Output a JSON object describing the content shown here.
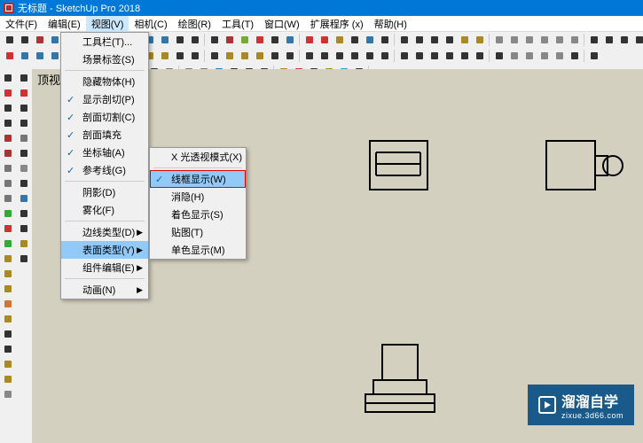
{
  "titlebar": {
    "appicon": "SU",
    "title": "无标题 - SketchUp Pro 2018"
  },
  "menubar": [
    {
      "label": "文件(F)"
    },
    {
      "label": "编辑(E)"
    },
    {
      "label": "视图(V)",
      "active": true
    },
    {
      "label": "相机(C)"
    },
    {
      "label": "绘图(R)"
    },
    {
      "label": "工具(T)"
    },
    {
      "label": "窗口(W)"
    },
    {
      "label": "扩展程序 (x)"
    },
    {
      "label": "帮助(H)"
    }
  ],
  "view_menu": {
    "items": [
      {
        "label": "工具栏(T)...",
        "check": false
      },
      {
        "label": "场景标签(S)",
        "check": false,
        "sep_after": true
      },
      {
        "label": "隐藏物体(H)",
        "check": false
      },
      {
        "label": "显示剖切(P)",
        "check": true
      },
      {
        "label": "剖面切割(C)",
        "check": true
      },
      {
        "label": "剖面填充",
        "check": true
      },
      {
        "label": "坐标轴(A)",
        "check": true
      },
      {
        "label": "参考线(G)",
        "check": true,
        "sep_after": true
      },
      {
        "label": "阴影(D)",
        "check": false
      },
      {
        "label": "雾化(F)",
        "check": false,
        "sep_after": true
      },
      {
        "label": "边线类型(D)",
        "check": false,
        "arrow": true
      },
      {
        "label": "表面类型(Y)",
        "check": false,
        "arrow": true,
        "highlighted": true
      },
      {
        "label": "组件编辑(E)",
        "check": false,
        "arrow": true,
        "sep_after": true
      },
      {
        "label": "动画(N)",
        "check": false,
        "arrow": true
      }
    ]
  },
  "surface_submenu": {
    "items": [
      {
        "label": "X 光透视模式(X)",
        "check": false,
        "sep_after": true
      },
      {
        "label": "线框显示(W)",
        "check": true,
        "highlighted": true,
        "red": true
      },
      {
        "label": "消隐(H)",
        "check": false
      },
      {
        "label": "着色显示(S)",
        "check": false
      },
      {
        "label": "贴图(T)",
        "check": false
      },
      {
        "label": "单色显示(M)",
        "check": false
      }
    ]
  },
  "canvas": {
    "view_label": "顶视图"
  },
  "watermark": {
    "line1": "溜溜自学",
    "line2": "zixue.3d66.com"
  },
  "toolbar_icons": {
    "row1_colors": [
      "#333",
      "#333",
      "#a33",
      "#37a",
      "#777",
      "#a82",
      "#7a3",
      "#888",
      "#a33",
      "#37a",
      "#37a",
      "#333",
      "#333",
      "#333",
      "#a33",
      "#7a3",
      "#c33",
      "#333",
      "#37a",
      "#c33",
      "#c33",
      "#a82",
      "#333",
      "#37a",
      "#333",
      "#333",
      "#333",
      "#333",
      "#333",
      "#a82",
      "#a82",
      "#888",
      "#888",
      "#888",
      "#888",
      "#888",
      "#888",
      "#333",
      "#333",
      "#333",
      "#333",
      "#888"
    ],
    "row2_colors": [
      "#c33",
      "#37a",
      "#37a",
      "#37a",
      "#37a",
      "#333",
      "#c73",
      "#c73",
      "#333",
      "#a82",
      "#a82",
      "#333",
      "#333",
      "#333",
      "#a82",
      "#a82",
      "#a82",
      "#333",
      "#333",
      "#333",
      "#333",
      "#333",
      "#333",
      "#333",
      "#333",
      "#333",
      "#333",
      "#333",
      "#333",
      "#333",
      "#333",
      "#333",
      "#888",
      "#888",
      "#888",
      "#888",
      "#333",
      "#333"
    ],
    "row3_colors": [
      "#333",
      "#333",
      "#333",
      "#333",
      "#333",
      "#333",
      "#777",
      "#777",
      "#777",
      "#37a",
      "#333",
      "#333",
      "#333",
      "#a82",
      "#c33",
      "#333",
      "#a82",
      "#39b",
      "#333"
    ],
    "left1_colors": [
      "#333",
      "#c33",
      "#333",
      "#333",
      "#a33",
      "#a33",
      "#777",
      "#777",
      "#777",
      "#3a3",
      "#c33",
      "#3a3",
      "#a82",
      "#a82",
      "#a82",
      "#c73",
      "#a82",
      "#333",
      "#333",
      "#a82",
      "#a82",
      "#888"
    ],
    "left2_colors": [
      "#333",
      "#c33",
      "#333",
      "#333",
      "#777",
      "#333",
      "#888",
      "#333",
      "#37a",
      "#333",
      "#333",
      "#a82",
      "#333"
    ]
  }
}
